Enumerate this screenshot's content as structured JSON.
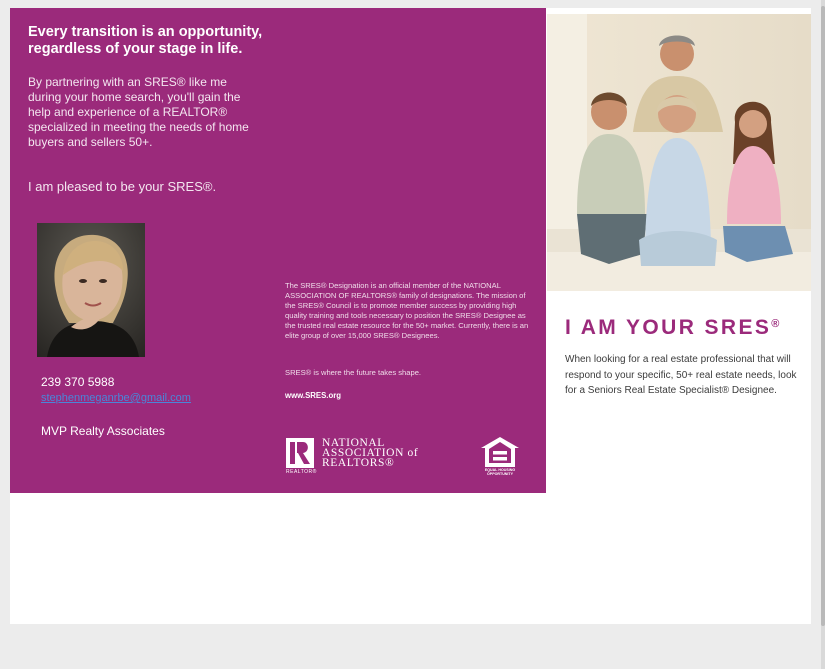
{
  "brochure": {
    "headline": "Every transition is an opportunity, regardless of your stage in life.",
    "intro": "By partnering with an SRES® like me during your home search, you'll gain the help and experience of a REALTOR® specialized in meeting the needs of home buyers and sellers 50+.",
    "pleased": "I am pleased to be your SRES®.",
    "contact": {
      "phone": "239 370 5988",
      "email": "stephenmeganrbe@gmail.com",
      "company": "MVP Realty Associates"
    },
    "about": "The SRES® Designation is an official member of the NATIONAL ASSOCIATION OF REALTORS® family of designations. The mission of the SRES® Council is to promote member success by providing high quality training and tools necessary to position the SRES® Designee as the trusted real estate resource for the 50+ market. Currently, there is an elite group of over 15,000 SRES® Designees.",
    "tagline": "SRES® is where the future takes shape.",
    "website": "www.SRES.org",
    "nar_logo": {
      "line1": "NATIONAL",
      "line2": "ASSOCIATION of",
      "line3": "REALTORS®",
      "realtor_mark": "REALTOR®"
    },
    "eho_logo": {
      "caption": "EQUAL HOUSING OPPORTUNITY"
    },
    "heading": "I AM YOUR SRES",
    "heading_mark": "®",
    "description": "When looking for a real estate professional that will respond to your specific, 50+ real estate needs, look for a Seniors Real Estate Specialist® Designee."
  },
  "colors": {
    "brand_purple": "#9b2a7b",
    "email_link": "#4a86d9"
  },
  "icons": {
    "nar": "realtor-r-logo-icon",
    "eho": "equal-housing-house-icon"
  }
}
